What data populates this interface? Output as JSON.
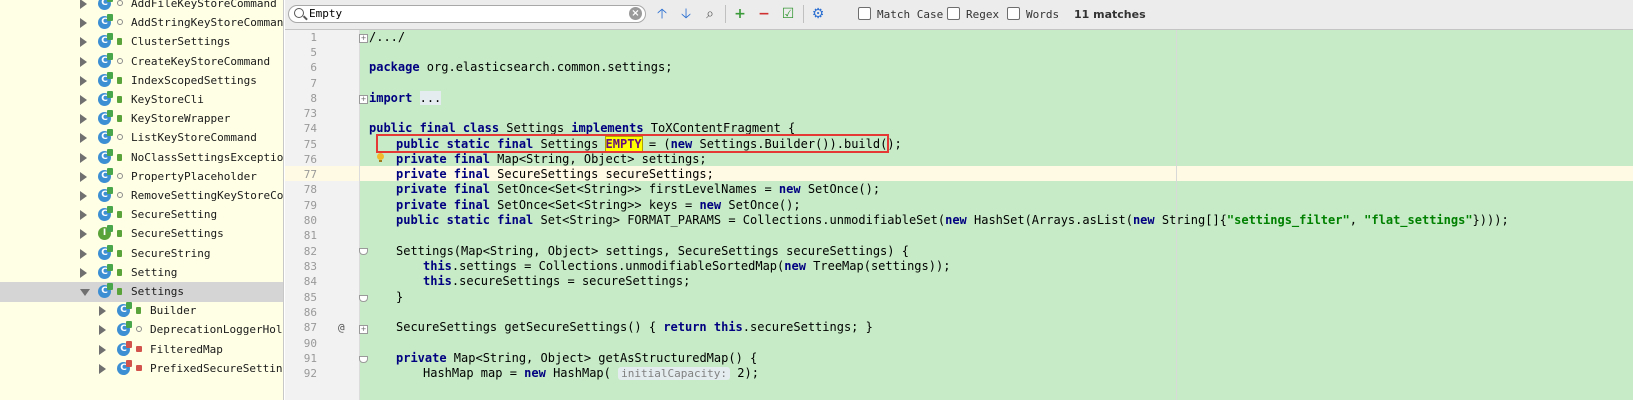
{
  "tree": {
    "items": [
      {
        "label": "AddFileKeyStoreCommand",
        "icon": "class-icon",
        "expanded": false,
        "visibility": "package"
      },
      {
        "label": "AddStringKeyStoreCommand",
        "icon": "class-icon",
        "expanded": false,
        "visibility": "package"
      },
      {
        "label": "ClusterSettings",
        "icon": "class-icon",
        "expanded": false,
        "visibility": "public"
      },
      {
        "label": "CreateKeyStoreCommand",
        "icon": "class-icon",
        "expanded": false,
        "visibility": "package"
      },
      {
        "label": "IndexScopedSettings",
        "icon": "class-icon",
        "expanded": false,
        "visibility": "public"
      },
      {
        "label": "KeyStoreCli",
        "icon": "class-icon",
        "expanded": false,
        "visibility": "public"
      },
      {
        "label": "KeyStoreWrapper",
        "icon": "class-icon",
        "expanded": false,
        "visibility": "public"
      },
      {
        "label": "ListKeyStoreCommand",
        "icon": "class-icon",
        "expanded": false,
        "visibility": "package"
      },
      {
        "label": "NoClassSettingsException",
        "icon": "class-icon",
        "expanded": false,
        "visibility": "public"
      },
      {
        "label": "PropertyPlaceholder",
        "icon": "class-icon",
        "expanded": false,
        "visibility": "package"
      },
      {
        "label": "RemoveSettingKeyStoreComman",
        "icon": "class-icon",
        "expanded": false,
        "visibility": "package"
      },
      {
        "label": "SecureSetting",
        "icon": "class-icon",
        "expanded": false,
        "visibility": "public"
      },
      {
        "label": "SecureSettings",
        "icon": "interface-icon",
        "expanded": false,
        "visibility": "public"
      },
      {
        "label": "SecureString",
        "icon": "class-icon",
        "expanded": false,
        "visibility": "public"
      },
      {
        "label": "Setting",
        "icon": "class-icon",
        "expanded": false,
        "visibility": "public"
      },
      {
        "label": "Settings",
        "icon": "class-icon",
        "expanded": true,
        "visibility": "public",
        "selected": true
      },
      {
        "label": "Builder",
        "icon": "class-icon",
        "expanded": false,
        "visibility": "public",
        "child": true
      },
      {
        "label": "DeprecationLoggerHolder",
        "icon": "class-icon",
        "expanded": false,
        "visibility": "package",
        "child": true
      },
      {
        "label": "FilteredMap",
        "icon": "class-icon",
        "expanded": false,
        "visibility": "private",
        "child": true
      },
      {
        "label": "PrefixedSecureSettings",
        "icon": "class-icon",
        "expanded": false,
        "visibility": "private",
        "child": true
      }
    ]
  },
  "findbar": {
    "search_value": "Empty",
    "match_case_label": "Match Case",
    "regex_label": "Regex",
    "words_label": "Words",
    "matches_text": "11 matches"
  },
  "editor": {
    "line_numbers": [
      "1",
      "5",
      "6",
      "7",
      "8",
      "73",
      "74",
      "75",
      "76",
      "77",
      "78",
      "79",
      "80",
      "81",
      "82",
      "83",
      "84",
      "85",
      "86",
      "87",
      "90",
      "91",
      "92"
    ],
    "lines": {
      "l1": "/.../",
      "l6": "package org.elasticsearch.common.settings;",
      "l8": "import ...",
      "l74a": "public final class",
      "l74b": " Settings ",
      "l74c": "implements",
      "l74d": " ToXContentFragment {",
      "l75a": "public static final",
      "l75b": " Settings ",
      "l75c": "EMPTY",
      "l75d": " = (",
      "l75e": "new",
      "l75f": " Settings.Builder()).build();",
      "l76a": "private final",
      "l76b": " Map<String, Object> settings;",
      "l77a": "private final",
      "l77b": " SecureSettings secureSettings;",
      "l78a": "private final",
      "l78b": " SetOnce<Set<String>> firstLevelNames = ",
      "l78c": "new",
      "l78d": " SetOnce();",
      "l79a": "private final",
      "l79b": " SetOnce<Set<String>> keys = ",
      "l79c": "new",
      "l79d": " SetOnce();",
      "l80a": "public static final",
      "l80b": " Set<String> FORMAT_PARAMS = Collections.unmodifiableSet(",
      "l80c": "new",
      "l80d": " HashSet(Arrays.asList(",
      "l80e": "new",
      "l80f": " String[]{",
      "l80g": "\"settings_filter\"",
      "l80h": ", ",
      "l80i": "\"flat_settings\"",
      "l80j": "})));",
      "l82": "Settings(Map<String, Object> settings, SecureSettings secureSettings) {",
      "l83a": "this",
      "l83b": ".settings = Collections.unmodifiableSortedMap(",
      "l83c": "new",
      "l83d": " TreeMap(settings));",
      "l84a": "this",
      "l84b": ".secureSettings = secureSettings;",
      "l85": "}",
      "l87a": "SecureSettings getSecureSettings() { ",
      "l87b": "return this",
      "l87c": ".secureSettings; }",
      "l91a": "private",
      "l91b": " Map<String, Object> getAsStructuredMap() {",
      "l92a": "HashMap map = ",
      "l92b": "new",
      "l92c": " HashMap( ",
      "l92d": "initialCapacity:",
      "l92e": " 2);"
    }
  }
}
